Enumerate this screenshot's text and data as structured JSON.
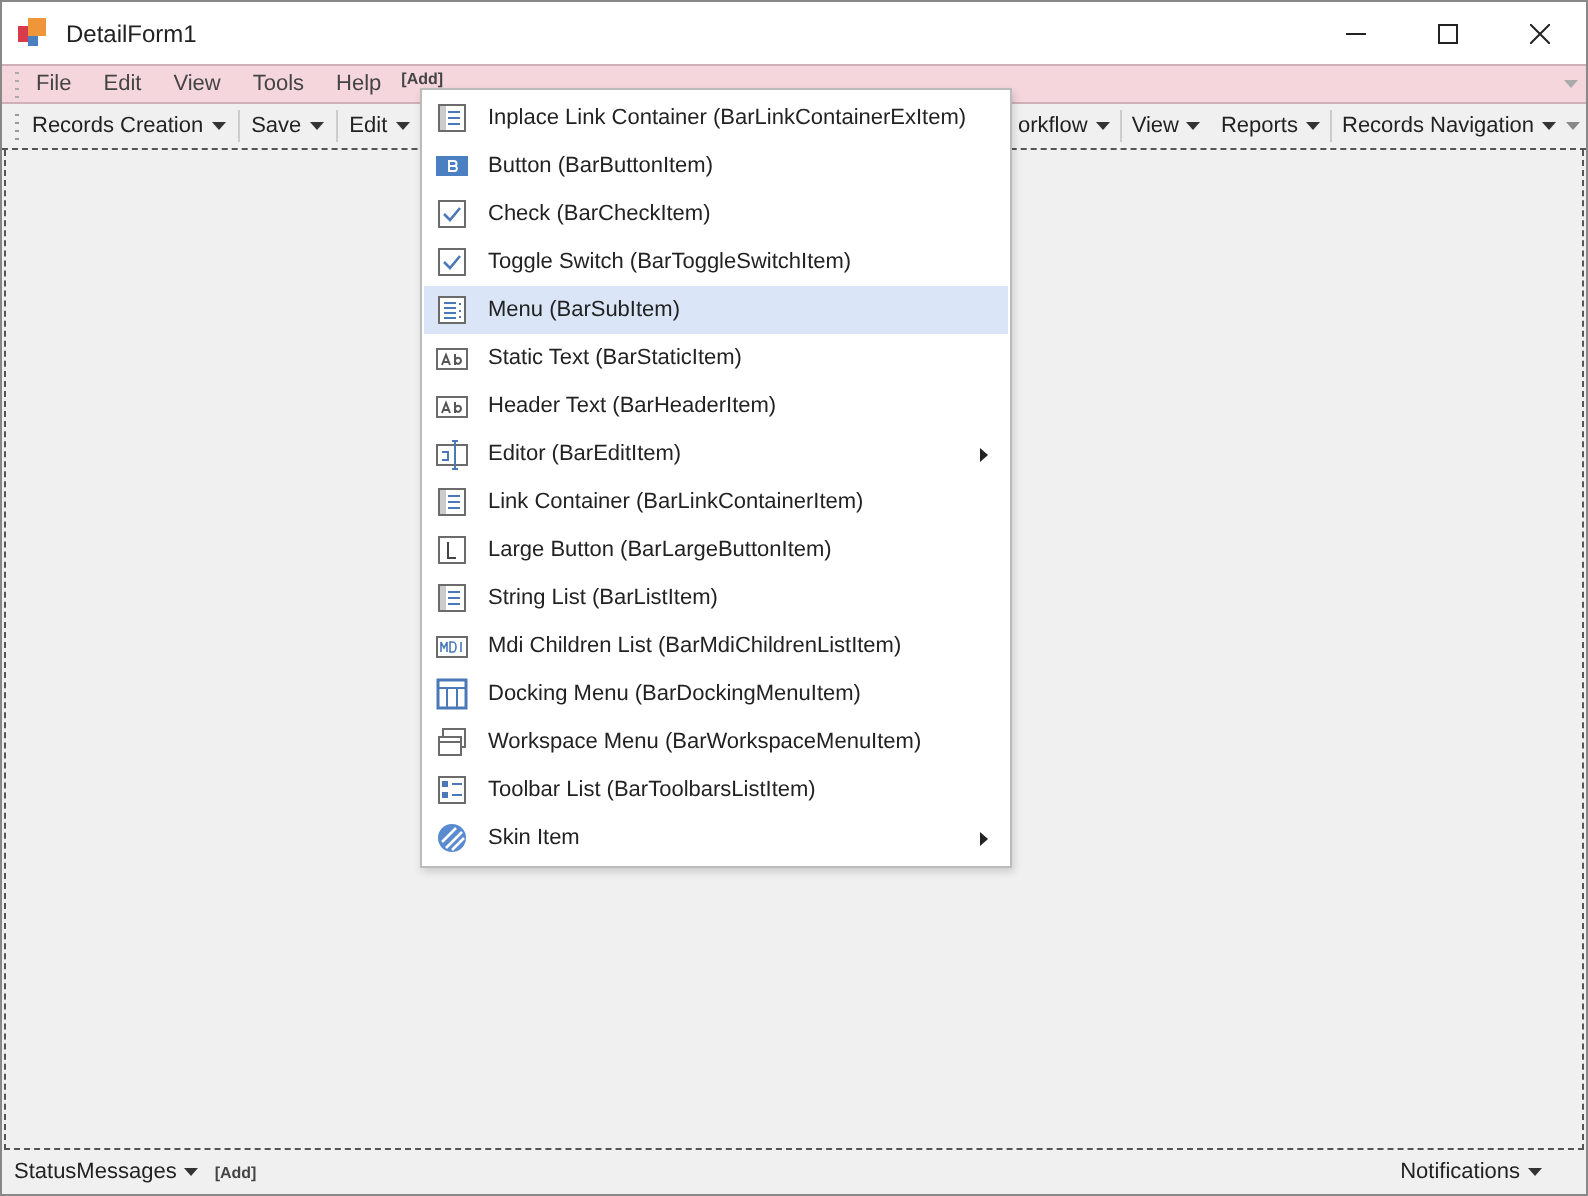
{
  "window": {
    "title": "DetailForm1"
  },
  "menu_bar": {
    "items": [
      "File",
      "Edit",
      "View",
      "Tools",
      "Help"
    ],
    "add_label": "[Add]"
  },
  "toolbar": {
    "left_items": [
      "Records Creation",
      "Save",
      "Edit"
    ],
    "right_items": [
      "orkflow",
      "View",
      "Reports",
      "Records Navigation"
    ]
  },
  "popup_menu": [
    {
      "kind": "list",
      "label": "Inplace Link Container (BarLinkContainerExItem)",
      "selected": false,
      "has_submenu": false
    },
    {
      "kind": "button",
      "label": "Button (BarButtonItem)",
      "selected": false,
      "has_submenu": false
    },
    {
      "kind": "check",
      "label": "Check (BarCheckItem)",
      "selected": false,
      "has_submenu": false
    },
    {
      "kind": "check",
      "label": "Toggle Switch (BarToggleSwitchItem)",
      "selected": false,
      "has_submenu": false
    },
    {
      "kind": "menu",
      "label": "Menu (BarSubItem)",
      "selected": true,
      "has_submenu": false
    },
    {
      "kind": "text",
      "label": "Static Text (BarStaticItem)",
      "selected": false,
      "has_submenu": false
    },
    {
      "kind": "text",
      "label": "Header Text (BarHeaderItem)",
      "selected": false,
      "has_submenu": false
    },
    {
      "kind": "editor",
      "label": "Editor (BarEditItem)",
      "selected": false,
      "has_submenu": true
    },
    {
      "kind": "list",
      "label": "Link Container (BarLinkContainerItem)",
      "selected": false,
      "has_submenu": false
    },
    {
      "kind": "large",
      "label": "Large Button (BarLargeButtonItem)",
      "selected": false,
      "has_submenu": false
    },
    {
      "kind": "list",
      "label": "String List (BarListItem)",
      "selected": false,
      "has_submenu": false
    },
    {
      "kind": "mdi",
      "label": "Mdi Children List (BarMdiChildrenListItem)",
      "selected": false,
      "has_submenu": false
    },
    {
      "kind": "docking",
      "label": "Docking Menu (BarDockingMenuItem)",
      "selected": false,
      "has_submenu": false
    },
    {
      "kind": "workspace",
      "label": "Workspace Menu (BarWorkspaceMenuItem)",
      "selected": false,
      "has_submenu": false
    },
    {
      "kind": "toolbars",
      "label": "Toolbar List (BarToolbarsListItem)",
      "selected": false,
      "has_submenu": false
    },
    {
      "kind": "skin",
      "label": "Skin Item",
      "selected": false,
      "has_submenu": true
    }
  ],
  "status_bar": {
    "left": "StatusMessages",
    "add_label": "[Add]",
    "right": "Notifications"
  }
}
